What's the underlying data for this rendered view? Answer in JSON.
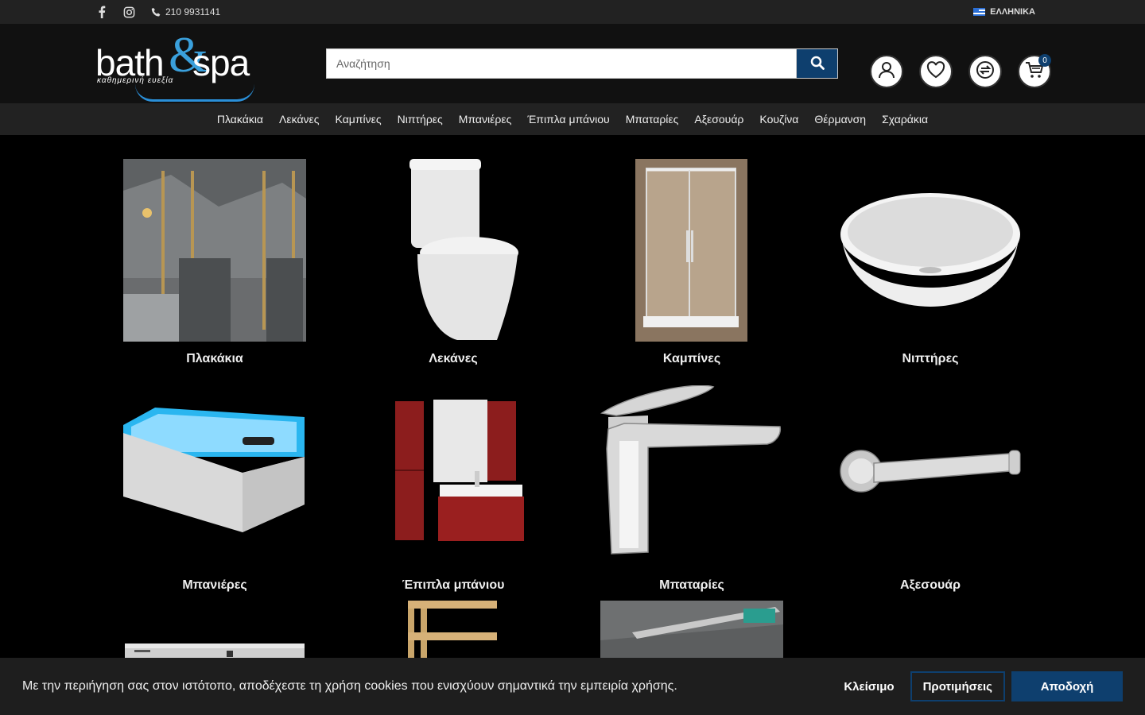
{
  "topbar": {
    "phone": "210 9931141",
    "language": "ΕΛΛΗΝΙΚΑ"
  },
  "logo": {
    "brand_left": "bath",
    "brand_amp": "&",
    "brand_right": "spa",
    "tagline": "καθημερινή ευεξία"
  },
  "search": {
    "placeholder": "Αναζήτηση"
  },
  "cart": {
    "count": "0"
  },
  "nav": [
    "Πλακάκια",
    "Λεκάνες",
    "Καμπίνες",
    "Νιπτήρες",
    "Μπανιέρες",
    "Έπιπλα μπάνιου",
    "Μπαταρίες",
    "Αξεσουάρ",
    "Κουζίνα",
    "Θέρμανση",
    "Σχαράκια"
  ],
  "categories": [
    {
      "label": "Πλακάκια",
      "icon": "tiles-image"
    },
    {
      "label": "Λεκάνες",
      "icon": "toilet-image"
    },
    {
      "label": "Καμπίνες",
      "icon": "shower-cabin-image"
    },
    {
      "label": "Νιπτήρες",
      "icon": "basin-image"
    },
    {
      "label": "Μπανιέρες",
      "icon": "bathtub-image"
    },
    {
      "label": "Έπιπλα μπάνιου",
      "icon": "bathroom-furniture-image"
    },
    {
      "label": "Μπαταρίες",
      "icon": "faucet-image"
    },
    {
      "label": "Αξεσουάρ",
      "icon": "accessory-image"
    },
    {
      "label": "",
      "icon": "kitchen-image"
    },
    {
      "label": "",
      "icon": "heating-image"
    },
    {
      "label": "",
      "icon": "drain-image"
    }
  ],
  "cookie": {
    "message": "Με την περιήγηση σας στον ιστότοπο, αποδέχεστε τη χρήση cookies που ενισχύουν σημαντικά την εμπειρία χρήσης.",
    "close": "Κλείσιμο",
    "preferences": "Προτιμήσεις",
    "accept": "Αποδοχή"
  },
  "colors": {
    "accent": "#0e3f6e",
    "logo_blue": "#3aa0dc"
  }
}
